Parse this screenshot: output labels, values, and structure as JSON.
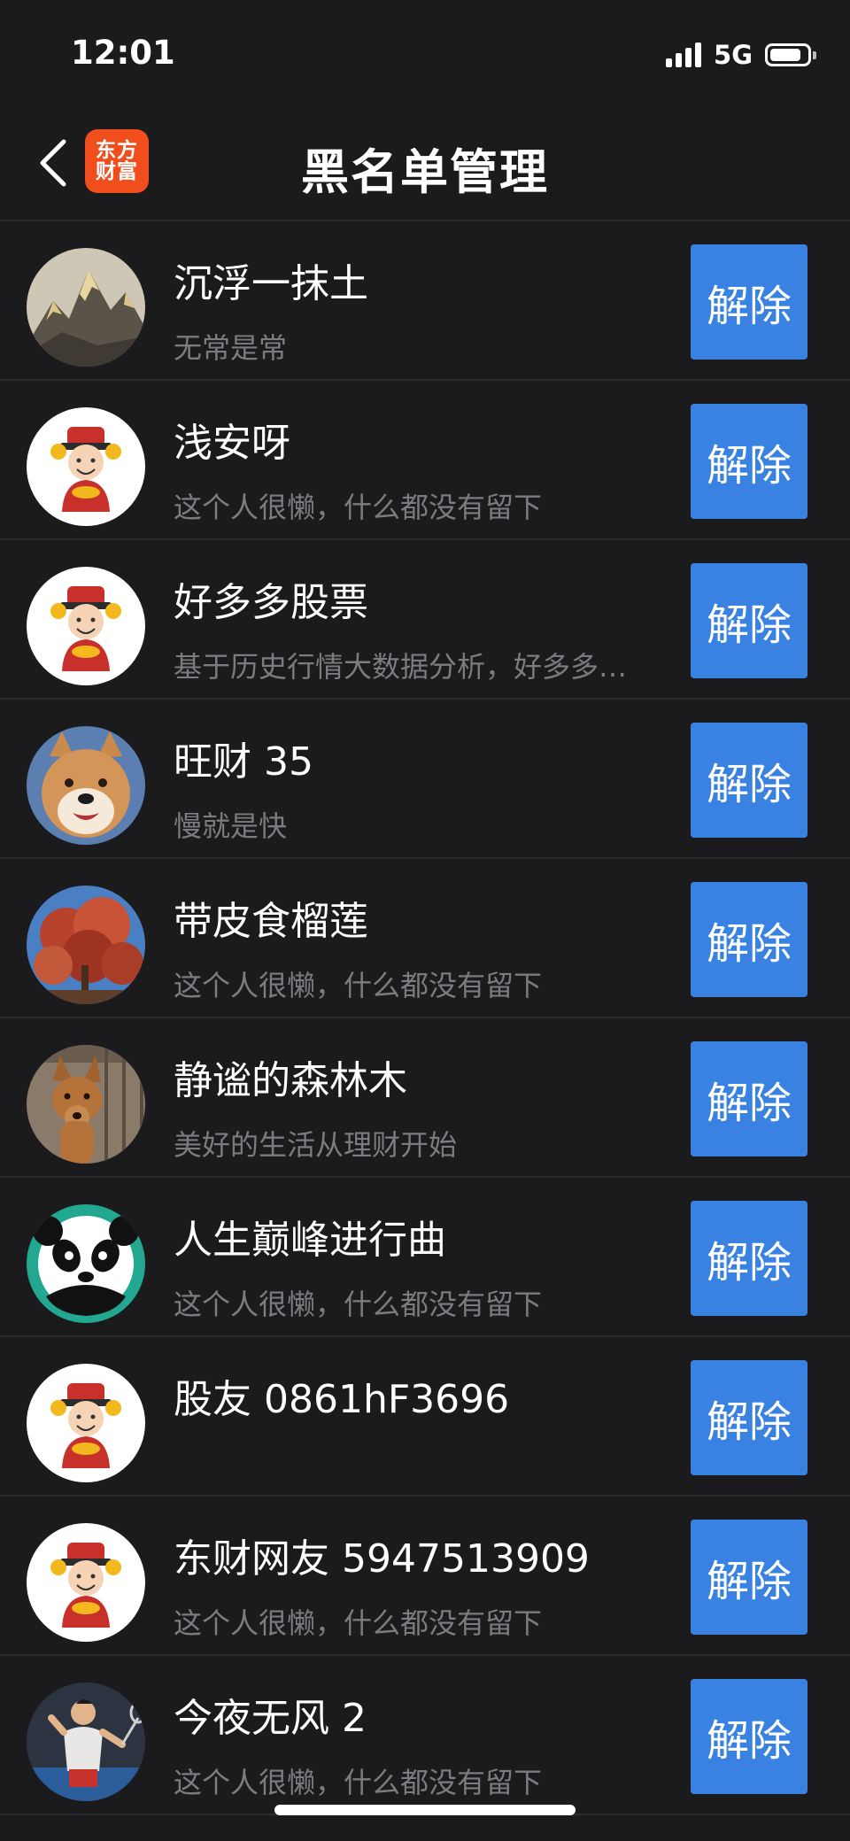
{
  "status_bar": {
    "time": "12:01",
    "network": "5G",
    "battery_level": 0.85
  },
  "header": {
    "back_icon": "chevron-left-icon",
    "logo_line1": "东方",
    "logo_line2": "财富",
    "title": "黑名单管理"
  },
  "colors": {
    "background": "#1b1b1d",
    "button": "#3a82e2",
    "logo": "#f04e1d",
    "secondary_text": "#7c7c80"
  },
  "blacklist": [
    {
      "name": "沉浮一抹土",
      "bio": "无常是常",
      "avatar": "mountain",
      "button": "解除"
    },
    {
      "name": "浅安呀",
      "bio": "这个人很懒，什么都没有留下",
      "avatar": "fortune-god",
      "button": "解除"
    },
    {
      "name": "好多多股票",
      "bio": "基于历史行情大数据分析，好多多股票",
      "avatar": "fortune-god",
      "button": "解除"
    },
    {
      "name": "旺财 35",
      "bio": "慢就是快",
      "avatar": "shiba-dog",
      "button": "解除"
    },
    {
      "name": "带皮食榴莲",
      "bio": "这个人很懒，什么都没有留下",
      "avatar": "autumn-tree",
      "button": "解除"
    },
    {
      "name": "静谧的森林木",
      "bio": "美好的生活从理财开始",
      "avatar": "brown-dog",
      "button": "解除"
    },
    {
      "name": "人生巅峰进行曲",
      "bio": "这个人很懒，什么都没有留下",
      "avatar": "panda",
      "button": "解除"
    },
    {
      "name": "股友 0861hF3696",
      "bio": "",
      "avatar": "fortune-god",
      "button": "解除"
    },
    {
      "name": "东财网友 5947513909",
      "bio": "这个人很懒，什么都没有留下",
      "avatar": "fortune-god",
      "button": "解除"
    },
    {
      "name": "今夜无风 2",
      "bio": "这个人很懒，什么都没有留下",
      "avatar": "badminton-player",
      "button": "解除"
    }
  ]
}
